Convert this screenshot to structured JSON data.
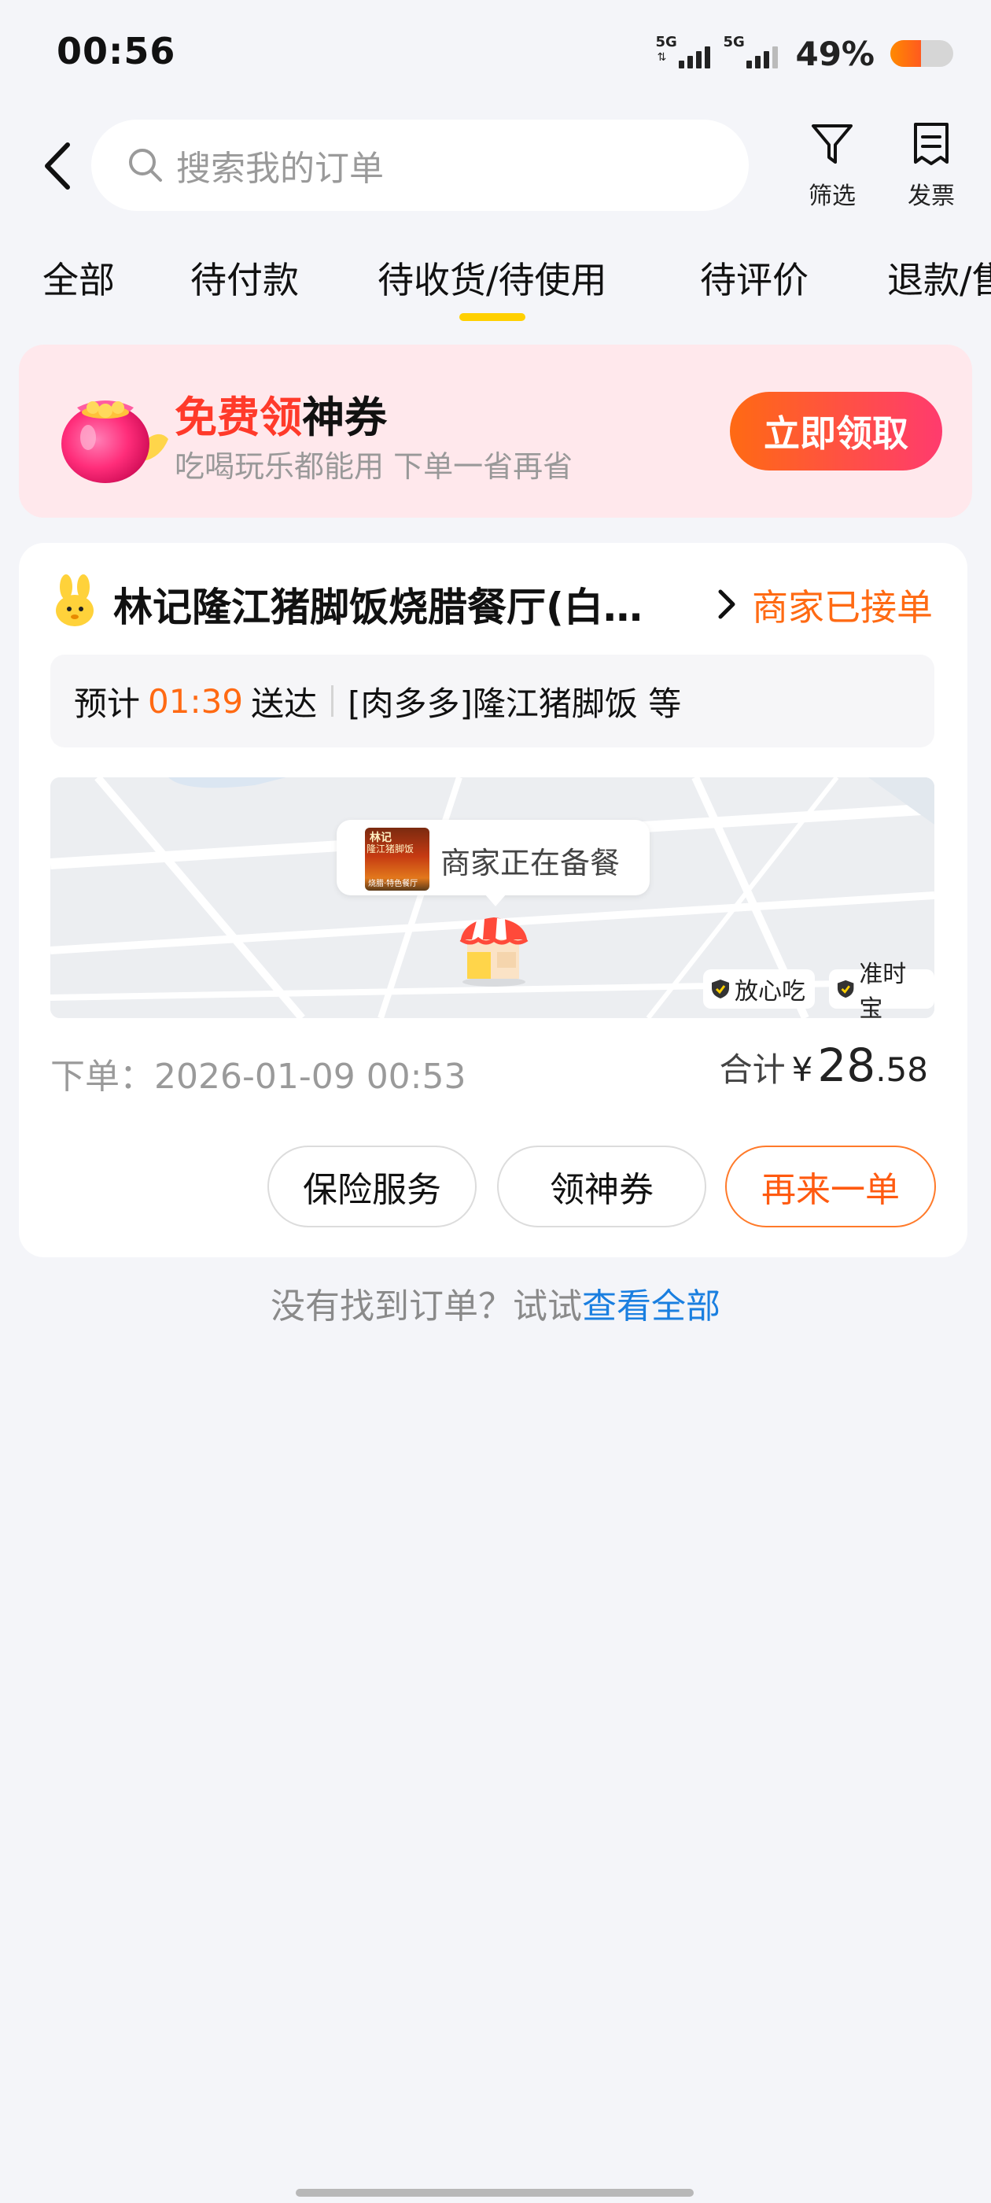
{
  "status_bar": {
    "time": "00:56",
    "signal1_label": "5G",
    "signal2_label": "5G",
    "battery_percent": "49%",
    "battery_level": 0.49
  },
  "header": {
    "search_placeholder": "搜索我的订单",
    "filter_label": "筛选",
    "invoice_label": "发票"
  },
  "tabs": [
    {
      "label": "全部",
      "active": false
    },
    {
      "label": "待付款",
      "active": false
    },
    {
      "label": "待收货/待使用",
      "active": true
    },
    {
      "label": "待评价",
      "active": false
    },
    {
      "label": "退款/售后",
      "active": false
    }
  ],
  "banner": {
    "title_red": "免费领",
    "title_rest": "神券",
    "subtitle": "吃喝玩乐都能用 下单一省再省",
    "button": "立即领取"
  },
  "order": {
    "shop_name": "林记隆江猪脚饭烧腊餐厅(白…",
    "status": "商家已接单",
    "eta_prefix": "预计",
    "eta_time": "01:39",
    "eta_suffix": "送达",
    "items": "[肉多多]隆江猪脚饭 等",
    "map_status": "商家正在备餐",
    "thumb_title": "林记",
    "thumb_name": "隆江猪脚饭",
    "thumb_tag": "烧腊·特色餐厅",
    "badge_safe": "放心吃",
    "badge_ontime": "准时宝",
    "order_time": "下单：2026-01-09 00:53",
    "total_label": "合计",
    "currency": "¥",
    "total_int": "28",
    "total_dec": ".58",
    "buttons": {
      "insurance": "保险服务",
      "coupon": "领神券",
      "reorder": "再来一单"
    }
  },
  "footer": {
    "hint": "没有找到订单？试试",
    "link": "查看全部"
  },
  "colors": {
    "accent_orange": "#ff6a13",
    "tab_indicator": "#ffd000",
    "link_blue": "#1a7fe0",
    "banner_bg": "#ffe8ec"
  }
}
